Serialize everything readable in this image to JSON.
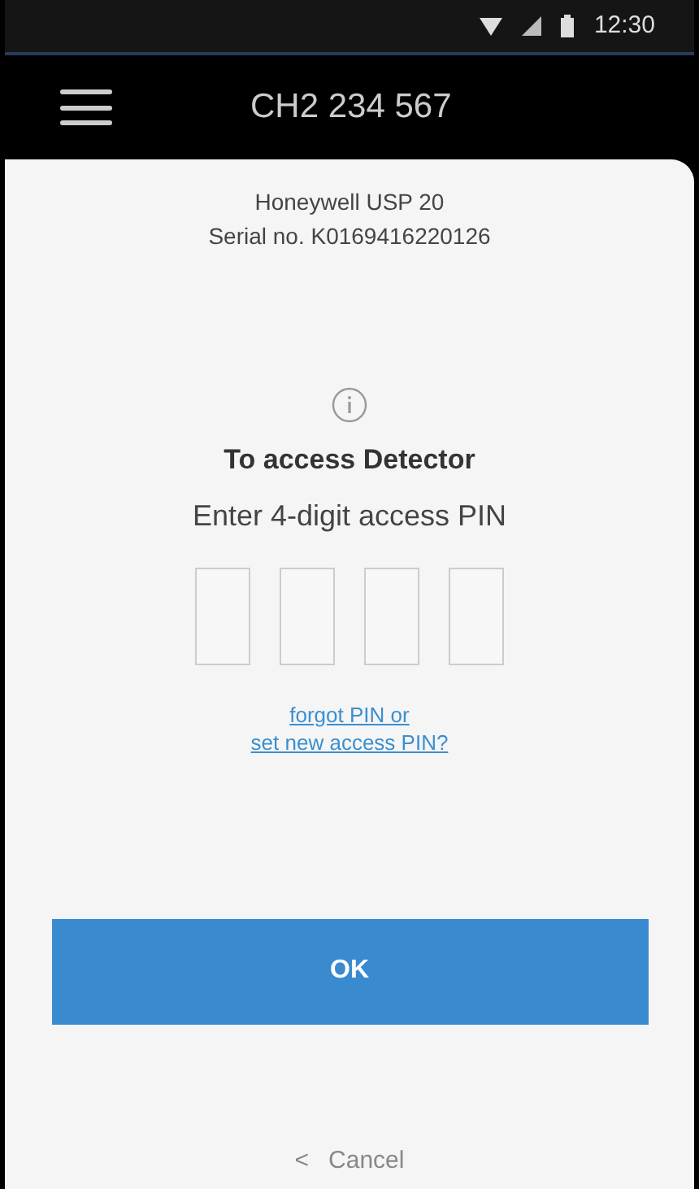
{
  "status_bar": {
    "time": "12:30"
  },
  "header": {
    "title": "CH2 234 567"
  },
  "device": {
    "name": "Honeywell USP 20",
    "serial": "Serial no. K0169416220126"
  },
  "prompt": {
    "title": "To access Detector",
    "instruction": "Enter 4-digit access PIN"
  },
  "pin_fields": [
    {
      "filled": false
    },
    {
      "filled": false
    },
    {
      "filled": false
    },
    {
      "filled": false
    }
  ],
  "links": [
    "forgot  PIN or",
    "set new access PIN?"
  ],
  "ok_button": "OK",
  "cancel": {
    "icon": "<",
    "label": "Cancel"
  }
}
